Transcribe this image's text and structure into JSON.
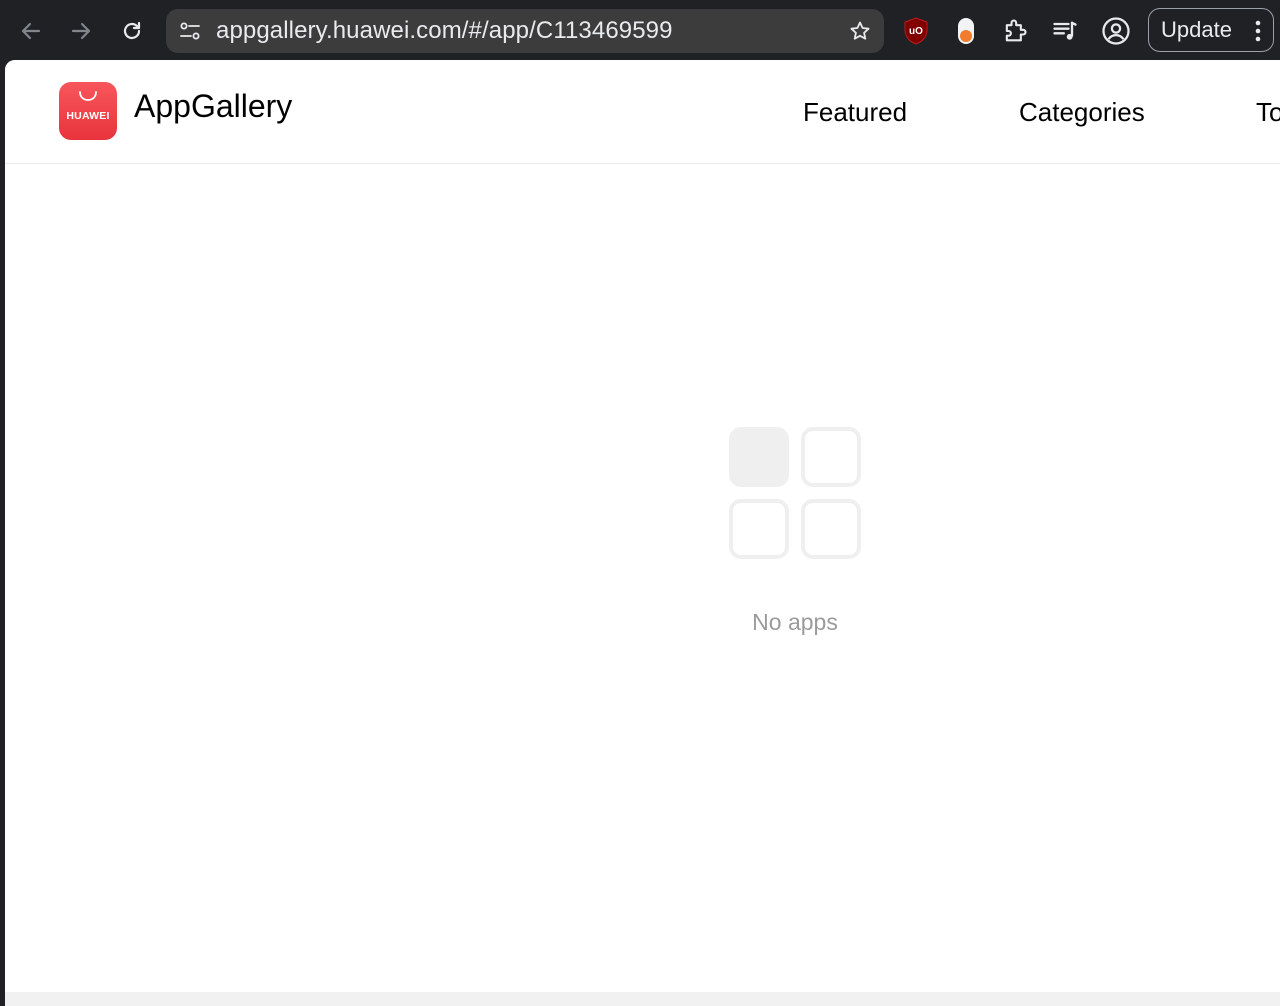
{
  "browser": {
    "url": "appgallery.huawei.com/#/app/C113469599",
    "update_label": "Update",
    "icons": [
      "back-arrow-icon",
      "forward-arrow-icon",
      "reload-icon",
      "site-settings-icon",
      "bookmark-star-icon",
      "ublock-shield-icon",
      "extension-toggle-icon",
      "puzzle-extensions-icon",
      "media-playlist-icon",
      "profile-icon",
      "more-menu-icon"
    ],
    "ublock_badge": "uO"
  },
  "page": {
    "logo_word": "HUAWEI",
    "brand": "AppGallery",
    "nav": [
      "Featured",
      "Categories",
      "To"
    ],
    "empty_state": "No apps",
    "colors": {
      "logo_red": "#f0434a",
      "empty_gray": "#9b9b9b",
      "placeholder": "#efefef"
    }
  }
}
